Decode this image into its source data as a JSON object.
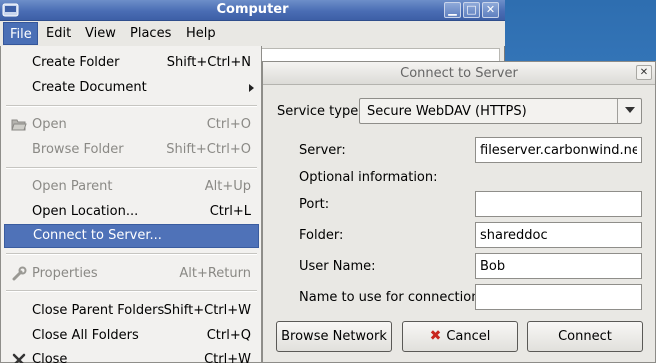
{
  "window": {
    "title": "Computer",
    "controls": {
      "minimize": "▁",
      "maximize": "□",
      "close": "✕"
    }
  },
  "menubar": [
    {
      "label": "File",
      "active": true
    },
    {
      "label": "Edit"
    },
    {
      "label": "View"
    },
    {
      "label": "Places"
    },
    {
      "label": "Help"
    }
  ],
  "file_menu": {
    "items": [
      {
        "label": "Create Folder",
        "accel": "Shift+Ctrl+N"
      },
      {
        "label": "Create Document",
        "submenu": true
      },
      {
        "label": "Open",
        "accel": "Ctrl+O",
        "disabled": true,
        "icon": "open-folder-icon"
      },
      {
        "label": "Browse Folder",
        "accel": "Shift+Ctrl+O",
        "disabled": true
      },
      {
        "label": "Open Parent",
        "accel": "Alt+Up",
        "disabled": true
      },
      {
        "label": "Open Location...",
        "accel": "Ctrl+L"
      },
      {
        "label": "Connect to Server...",
        "selected": true
      },
      {
        "label": "Properties",
        "accel": "Alt+Return",
        "disabled": true,
        "icon": "wrench-icon"
      },
      {
        "label": "Close Parent Folders",
        "accel": "Shift+Ctrl+W"
      },
      {
        "label": "Close All Folders",
        "accel": "Ctrl+Q"
      },
      {
        "label": "Close",
        "accel": "Ctrl+W",
        "icon": "close-icon"
      }
    ]
  },
  "dialog": {
    "title": "Connect to Server",
    "close_glyph": "✕",
    "service_type_label": "Service type:",
    "service_type_value": "Secure WebDAV (HTTPS)",
    "server_label": "Server:",
    "server_value": "fileserver.carbonwind.net",
    "optional_label": "Optional information:",
    "port_label": "Port:",
    "port_value": "",
    "folder_label": "Folder:",
    "folder_value": "shareddoc",
    "username_label": "User Name:",
    "username_value": "Bob",
    "connname_label": "Name to use for connection:",
    "connname_value": "",
    "buttons": {
      "browse": "Browse Network",
      "cancel": "Cancel",
      "connect": "Connect"
    }
  }
}
